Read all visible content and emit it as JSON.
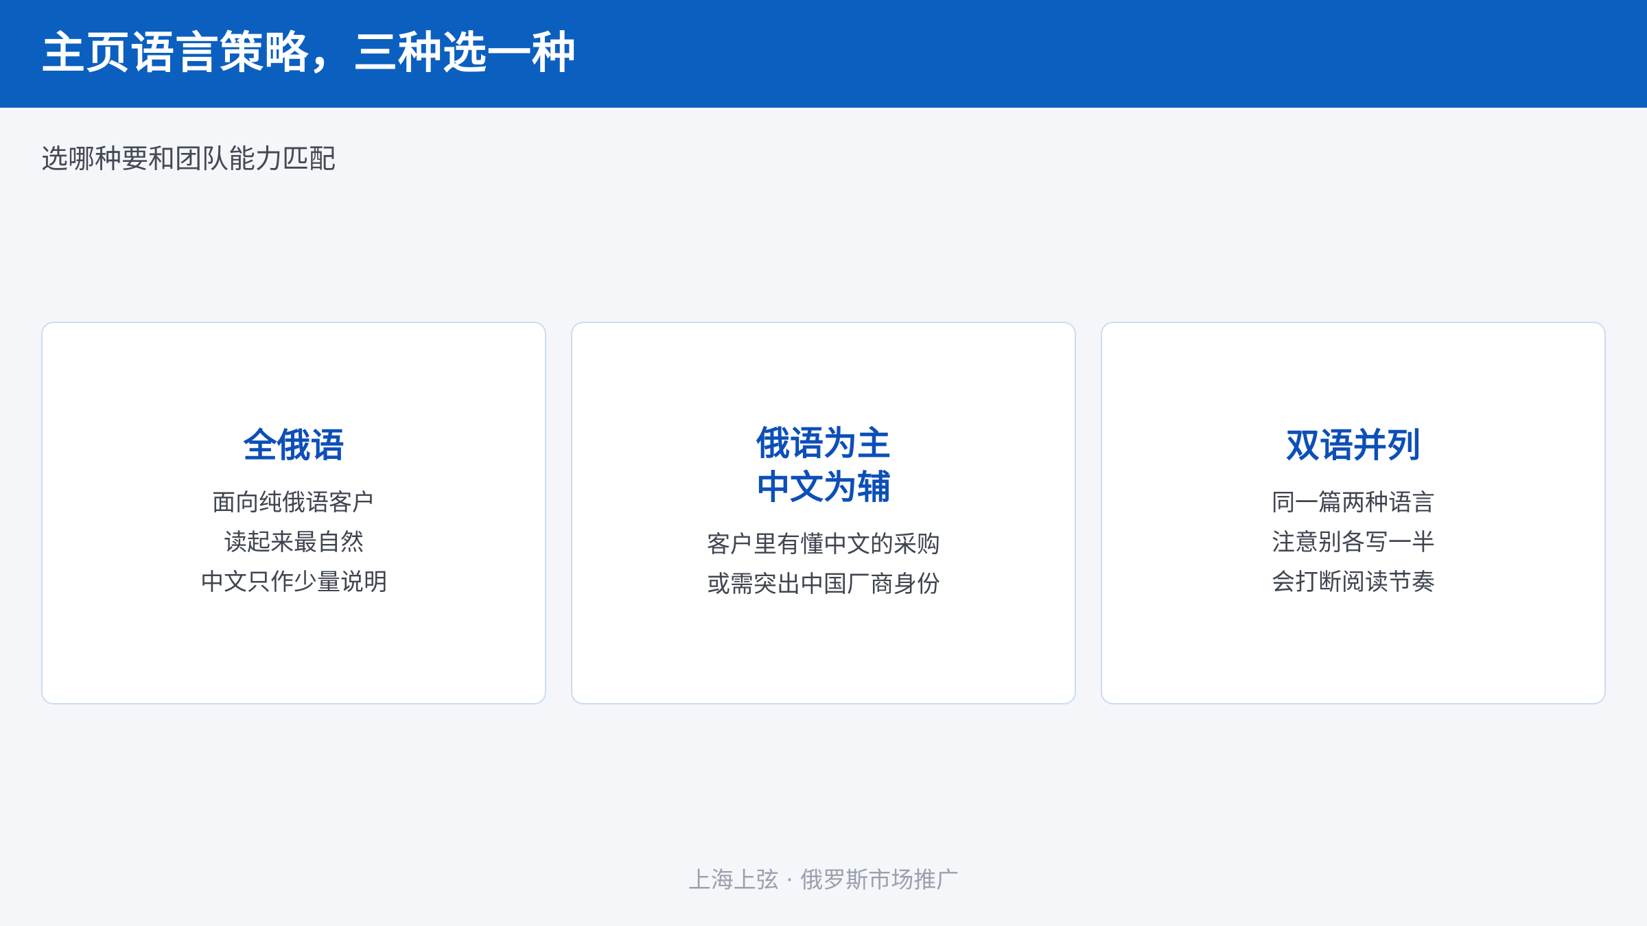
{
  "header": {
    "title": "主页语言策略，三种选一种",
    "background_color": "#0b5fbf"
  },
  "subtitle": "选哪种要和团队能力匹配",
  "cards": [
    {
      "title_lines": [
        "全俄语"
      ],
      "lines": [
        "面向纯俄语客户",
        "读起来最自然",
        "中文只作少量说明"
      ]
    },
    {
      "title_lines": [
        "俄语为主",
        "中文为辅"
      ],
      "lines": [
        "客户里有懂中文的采购",
        "或需突出中国厂商身份"
      ]
    },
    {
      "title_lines": [
        "双语并列"
      ],
      "lines": [
        "同一篇两种语言",
        "注意别各写一半",
        "会打断阅读节奏"
      ]
    }
  ],
  "footer": "上海上弦 · 俄罗斯市场推广",
  "colors": {
    "accent": "#0d4fb8",
    "card_border": "#cbdcf2",
    "page_background": "#f4f6fa"
  }
}
